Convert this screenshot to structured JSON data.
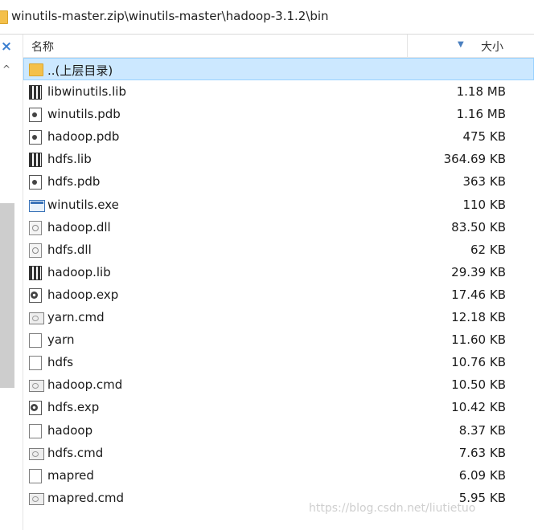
{
  "address": {
    "path": "winutils-master.zip\\winutils-master\\hadoop-3.1.2\\bin"
  },
  "header": {
    "name_label": "名称",
    "size_label": "大小",
    "sort_arrow": "▼"
  },
  "left": {
    "close_glyph": "×",
    "up_glyph": "^"
  },
  "files": [
    {
      "name": "..(上层目录)",
      "size": "",
      "icon": "folder-icon"
    },
    {
      "name": "libwinutils.lib",
      "size": "1.18 MB",
      "icon": "lib-icon"
    },
    {
      "name": "winutils.pdb",
      "size": "1.16 MB",
      "icon": "pdb-icon"
    },
    {
      "name": "hadoop.pdb",
      "size": "475 KB",
      "icon": "pdb-icon"
    },
    {
      "name": "hdfs.lib",
      "size": "364.69 KB",
      "icon": "lib-icon"
    },
    {
      "name": "hdfs.pdb",
      "size": "363 KB",
      "icon": "pdb-icon"
    },
    {
      "name": "winutils.exe",
      "size": "110 KB",
      "icon": "exe-icon"
    },
    {
      "name": "hadoop.dll",
      "size": "83.50 KB",
      "icon": "dll-icon"
    },
    {
      "name": "hdfs.dll",
      "size": "62 KB",
      "icon": "dll-icon"
    },
    {
      "name": "hadoop.lib",
      "size": "29.39 KB",
      "icon": "lib-icon"
    },
    {
      "name": "hadoop.exp",
      "size": "17.46 KB",
      "icon": "exp-icon"
    },
    {
      "name": "yarn.cmd",
      "size": "12.18 KB",
      "icon": "cmd-icon"
    },
    {
      "name": "yarn",
      "size": "11.60 KB",
      "icon": "file-icon"
    },
    {
      "name": "hdfs",
      "size": "10.76 KB",
      "icon": "file-icon"
    },
    {
      "name": "hadoop.cmd",
      "size": "10.50 KB",
      "icon": "cmd-icon"
    },
    {
      "name": "hdfs.exp",
      "size": "10.42 KB",
      "icon": "exp-icon"
    },
    {
      "name": "hadoop",
      "size": "8.37 KB",
      "icon": "file-icon"
    },
    {
      "name": "hdfs.cmd",
      "size": "7.63 KB",
      "icon": "cmd-icon"
    },
    {
      "name": "mapred",
      "size": "6.09 KB",
      "icon": "file-icon"
    },
    {
      "name": "mapred.cmd",
      "size": "5.95 KB",
      "icon": "cmd-icon"
    }
  ],
  "watermark": "https://blog.csdn.net/liutietuo",
  "colors": {
    "selection": "#cce8ff",
    "folder": "#f4c04a",
    "accent": "#3b7fd1"
  }
}
